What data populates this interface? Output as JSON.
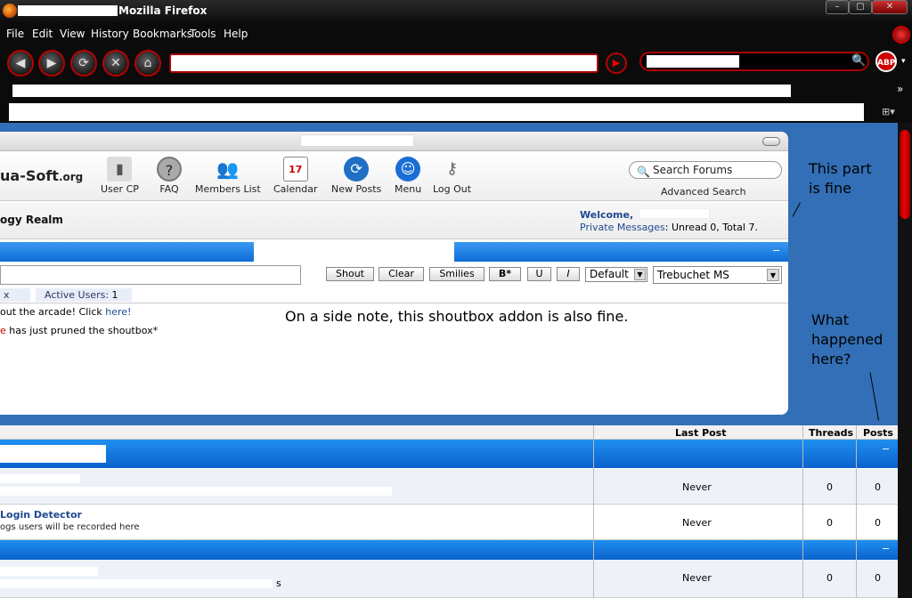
{
  "window": {
    "title": "Mozilla Firefox"
  },
  "menu": [
    "File",
    "Edit",
    "View",
    "History",
    "Bookmarks",
    "Tools",
    "Help"
  ],
  "search_engine_badge": "ABP",
  "forum": {
    "logo": "ua-Soft",
    "logo_suffix": ".org",
    "nav": [
      {
        "label": "User CP",
        "icon": "user-cp-icon"
      },
      {
        "label": "FAQ",
        "icon": "faq-icon"
      },
      {
        "label": "Members List",
        "icon": "members-icon"
      },
      {
        "label": "Calendar",
        "icon": "calendar-icon",
        "glyph": "17"
      },
      {
        "label": "New Posts",
        "icon": "new-posts-icon"
      },
      {
        "label": "Menu",
        "icon": "menu-icon"
      },
      {
        "label": "Log Out",
        "icon": "logout-icon"
      }
    ],
    "search_placeholder": "Search Forums",
    "advanced_search": "Advanced Search",
    "site_name": "ogy Realm",
    "welcome": "Welcome,",
    "pm_link": "Private Messages",
    "pm_counts": ": Unread 0, Total 7.",
    "shoutbox": {
      "buttons": [
        "Shout",
        "Clear",
        "Smilies",
        "B*",
        "U",
        "I"
      ],
      "size_select": "Default",
      "font_select": "Trebuchet MS",
      "tabs": [
        {
          "label": "x"
        },
        {
          "label": "Active Users:",
          "count": "1"
        }
      ],
      "messages": [
        {
          "text": "out the arcade! Click ",
          "link": "here!"
        },
        {
          "prefix": "e",
          "text": " has just pruned the shoutbox*"
        }
      ]
    }
  },
  "table": {
    "headers": {
      "last_post": "Last Post",
      "threads": "Threads",
      "posts": "Posts"
    },
    "rows": [
      {
        "title": "Login Detector",
        "last": "Never",
        "threads": "0",
        "posts": "0"
      },
      {
        "title": "",
        "last": "Never",
        "threads": "0",
        "posts": "0"
      },
      {
        "title": "",
        "suffix": "s",
        "last": "Never",
        "threads": "0",
        "posts": "0"
      }
    ],
    "row1_desc": "ogs users will be recorded here"
  },
  "annotations": {
    "fine": "This part\nis fine",
    "shoutbox": "On a side note, this shoutbox addon is also fine.",
    "what": "What\nhappened\nhere?"
  }
}
